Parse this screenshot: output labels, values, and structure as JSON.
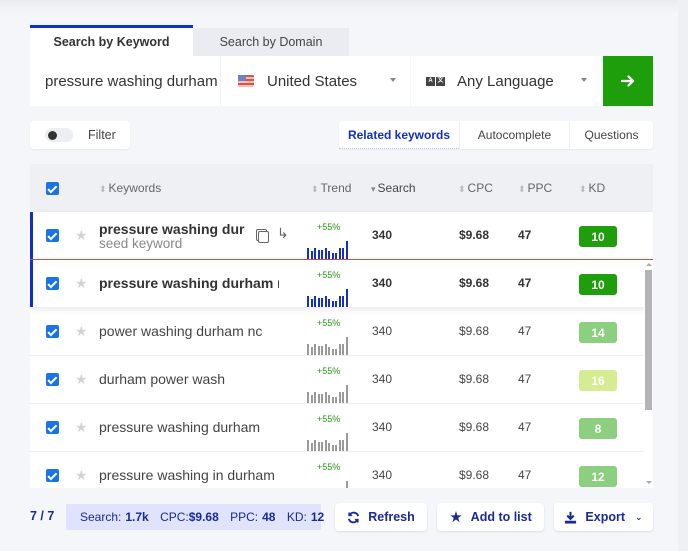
{
  "tabs": [
    {
      "label": "Search by Keyword",
      "active": true
    },
    {
      "label": "Search by Domain",
      "active": false
    }
  ],
  "search": {
    "keyword_value": "pressure washing durham",
    "country": "United States",
    "country_flag": "us-flag-icon",
    "language": "Any Language",
    "go_icon": "arrow-right-icon"
  },
  "filter": {
    "label": "Filter",
    "enabled": false
  },
  "modes": [
    {
      "label": "Related keywords",
      "active": true
    },
    {
      "label": "Autocomplete",
      "active": false
    },
    {
      "label": "Questions",
      "active": false
    }
  ],
  "table": {
    "columns": {
      "keywords": "Keywords",
      "trend": "Trend",
      "search": "Search",
      "cpc": "CPC",
      "ppc": "PPC",
      "kd": "KD"
    },
    "sorted_by": "Search",
    "select_all": true,
    "seed_label": "seed keyword",
    "trend_bars": [
      0.6,
      0.45,
      0.6,
      0.5,
      0.5,
      0.6,
      0.45,
      0.35,
      0.35,
      0.6,
      0.6,
      1.0
    ],
    "rows": [
      {
        "keyword": "pressure washing durham",
        "seed": true,
        "checked": true,
        "trend": "+55%",
        "search": "340",
        "cpc": "$9.68",
        "ppc": "47",
        "kd": "10",
        "kd_color": "#1f9e0c"
      },
      {
        "keyword": "pressure washing durham nc",
        "seed": false,
        "pinned": true,
        "checked": true,
        "trend": "+55%",
        "search": "340",
        "cpc": "$9.68",
        "ppc": "47",
        "kd": "10",
        "kd_color": "#1f9e0c"
      },
      {
        "keyword": "power washing durham nc",
        "checked": true,
        "trend": "+55%",
        "search": "340",
        "cpc": "$9.68",
        "ppc": "47",
        "kd": "14",
        "kd_color": "#8ccf7e"
      },
      {
        "keyword": "durham power wash",
        "checked": true,
        "trend": "+55%",
        "search": "340",
        "cpc": "$9.68",
        "ppc": "47",
        "kd": "16",
        "kd_color": "#d6ec93"
      },
      {
        "keyword": "pressure washing durham",
        "checked": true,
        "trend": "+55%",
        "search": "340",
        "cpc": "$9.68",
        "ppc": "47",
        "kd": "8",
        "kd_color": "#8ccf7e"
      },
      {
        "keyword": "pressure washing in durham",
        "checked": true,
        "trend": "+55%",
        "search": "340",
        "cpc": "$9.68",
        "ppc": "47",
        "kd": "12",
        "kd_color": "#8ccf7e"
      }
    ]
  },
  "footer": {
    "count": "7 / 7",
    "summary": {
      "search_label": "Search:",
      "search_value": "1.7k",
      "cpc_label": "CPC:",
      "cpc_value": "$9.68",
      "ppc_label": "PPC:",
      "ppc_value": "48",
      "kd_label": "KD:",
      "kd_value": "12"
    },
    "buttons": {
      "refresh": "Refresh",
      "add_to_list": "Add to list",
      "export": "Export"
    }
  },
  "colors": {
    "accent": "#1230c9",
    "go_button": "#1f9e0c",
    "trend_positive": "#1c9a10",
    "seed_divider": "#e34b3b"
  }
}
